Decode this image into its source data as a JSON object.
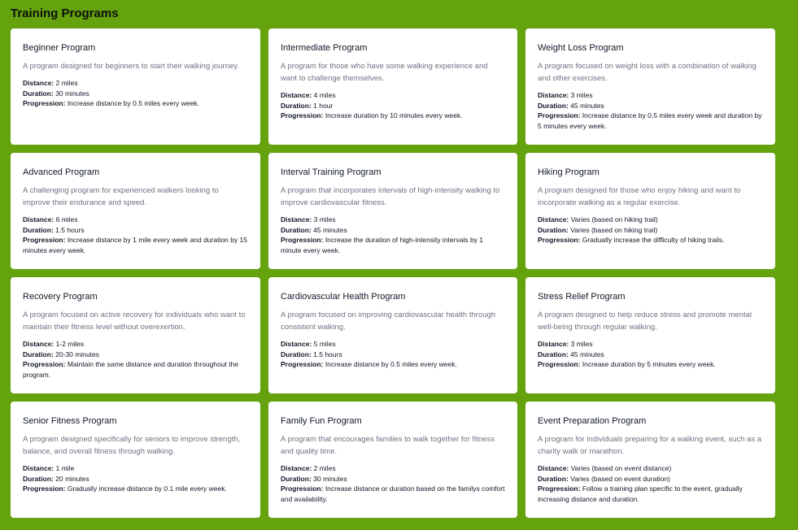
{
  "page": {
    "title": "Training Programs"
  },
  "labels": {
    "distance": "Distance:",
    "duration": "Duration:",
    "progression": "Progression:"
  },
  "programs": [
    {
      "title": "Beginner Program",
      "description": "A program designed for beginners to start their walking journey.",
      "distance": "2 miles",
      "duration": "30 minutes",
      "progression": "Increase distance by 0.5 miles every week."
    },
    {
      "title": "Intermediate Program",
      "description": "A program for those who have some walking experience and want to challenge themselves.",
      "distance": "4 miles",
      "duration": "1 hour",
      "progression": "Increase duration by 10 minutes every week."
    },
    {
      "title": "Weight Loss Program",
      "description": "A program focused on weight loss with a combination of walking and other exercises.",
      "distance": "3 miles",
      "duration": "45 minutes",
      "progression": "Increase distance by 0.5 miles every week and duration by 5 minutes every week."
    },
    {
      "title": "Advanced Program",
      "description": "A challenging program for experienced walkers looking to improve their endurance and speed.",
      "distance": "6 miles",
      "duration": "1.5 hours",
      "progression": "Increase distance by 1 mile every week and duration by 15 minutes every week."
    },
    {
      "title": "Interval Training Program",
      "description": "A program that incorporates intervals of high-intensity walking to improve cardiovascular fitness.",
      "distance": "3 miles",
      "duration": "45 minutes",
      "progression": "Increase the duration of high-intensity intervals by 1 minute every week."
    },
    {
      "title": "Hiking Program",
      "description": "A program designed for those who enjoy hiking and want to incorporate walking as a regular exercise.",
      "distance": "Varies (based on hiking trail)",
      "duration": "Varies (based on hiking trail)",
      "progression": "Gradually increase the difficulty of hiking trails."
    },
    {
      "title": "Recovery Program",
      "description": "A program focused on active recovery for individuals who want to maintain their fitness level without overexertion.",
      "distance": "1-2 miles",
      "duration": "20-30 minutes",
      "progression": "Maintain the same distance and duration throughout the program."
    },
    {
      "title": "Cardiovascular Health Program",
      "description": "A program focused on improving cardiovascular health through consistent walking.",
      "distance": "5 miles",
      "duration": "1.5 hours",
      "progression": "Increase distance by 0.5 miles every week."
    },
    {
      "title": "Stress Relief Program",
      "description": "A program designed to help reduce stress and promote mental well-being through regular walking.",
      "distance": "3 miles",
      "duration": "45 minutes",
      "progression": "Increase duration by 5 minutes every week."
    },
    {
      "title": "Senior Fitness Program",
      "description": "A program designed specifically for seniors to improve strength, balance, and overall fitness through walking.",
      "distance": "1 mile",
      "duration": "20 minutes",
      "progression": "Gradually increase distance by 0.1 mile every week."
    },
    {
      "title": "Family Fun Program",
      "description": "A program that encourages families to walk together for fitness and quality time.",
      "distance": "2 miles",
      "duration": "30 minutes",
      "progression": "Increase distance or duration based on the familys comfort and availability."
    },
    {
      "title": "Event Preparation Program",
      "description": "A program for individuals preparing for a walking event, such as a charity walk or marathon.",
      "distance": "Varies (based on event distance)",
      "duration": "Varies (based on event duration)",
      "progression": "Follow a training plan specific to the event, gradually increasing distance and duration."
    }
  ]
}
